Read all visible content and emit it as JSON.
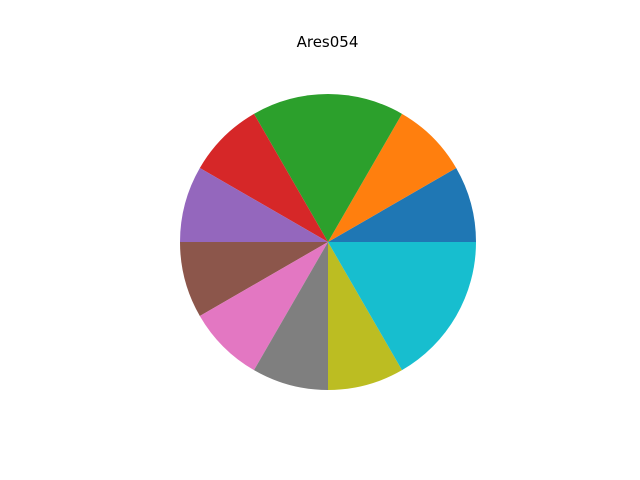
{
  "chart_data": {
    "type": "pie",
    "title": "Ares054",
    "slices": [
      {
        "value": 1,
        "color": "#1f77b4"
      },
      {
        "value": 1,
        "color": "#ff7f0e"
      },
      {
        "value": 2,
        "color": "#2ca02c"
      },
      {
        "value": 1,
        "color": "#d62728"
      },
      {
        "value": 1,
        "color": "#9467bd"
      },
      {
        "value": 1,
        "color": "#8c564b"
      },
      {
        "value": 1,
        "color": "#e377c2"
      },
      {
        "value": 1,
        "color": "#7f7f7f"
      },
      {
        "value": 1,
        "color": "#bcbd22"
      },
      {
        "value": 2,
        "color": "#17becf"
      }
    ],
    "start_angle_deg": 0,
    "direction": "counterclockwise",
    "legend": "none",
    "labels_shown": false
  }
}
